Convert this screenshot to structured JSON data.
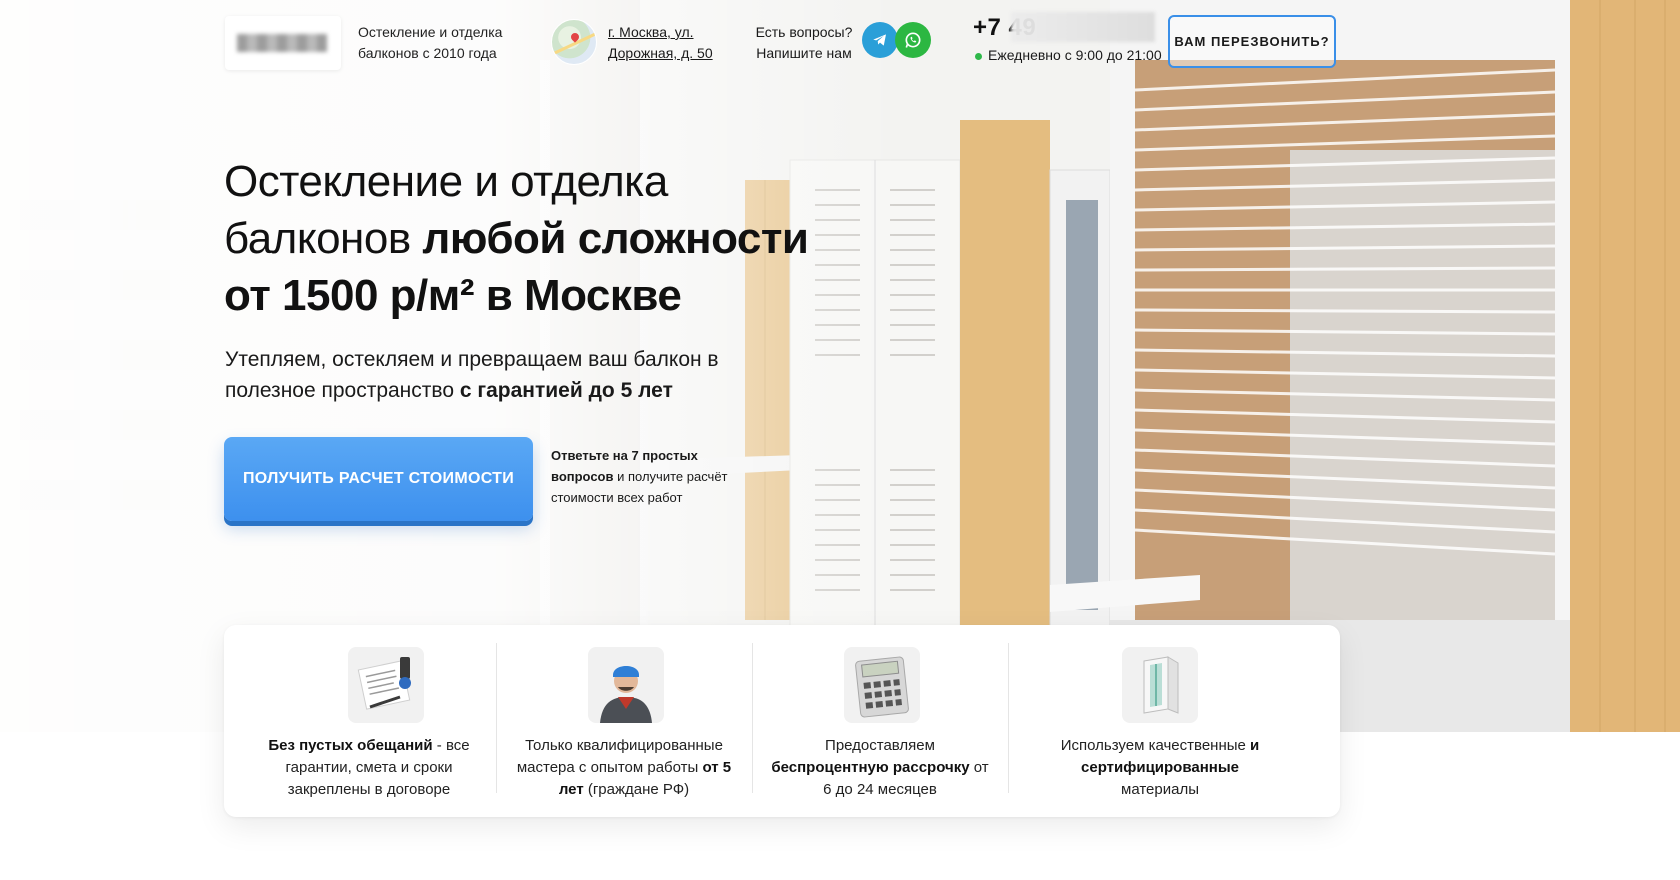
{
  "header": {
    "tagline": "Остекление и отделка балконов с 2010 года",
    "address_line1": "г. Москва, ул.",
    "address_line2": "Дорожная, д. 50",
    "questions_line1": "Есть вопросы?",
    "questions_line2": "Напишите нам",
    "phone": "+7 49",
    "hours": "Ежедневно с 9:00 до 21:00",
    "callback_label": "ВАМ ПЕРЕЗВОНИТЬ?"
  },
  "hero": {
    "title_line1": "Остекление и отделка",
    "title_line2_normal": "балконов ",
    "title_line2_bold": "любой сложности",
    "title_line3": "от 1500 р/м² в Москве",
    "subtitle_normal": "Утепляем, остекляем и превращаем ваш балкон в полезное пространство ",
    "subtitle_bold": "с гарантией до 5 лет",
    "cta_label": "ПОЛУЧИТЬ РАСЧЕТ СТОИМОСТИ",
    "cta_note_bold": "Ответьте на 7 простых вопросов",
    "cta_note_normal": " и получите расчёт стоимости всех работ"
  },
  "features": [
    {
      "icon": "document-icon",
      "bold": "Без пустых обещаний",
      "text_after": " - все гарантии, смета и сроки закреплены в договоре"
    },
    {
      "icon": "worker-icon",
      "text_before": "Только квалифицированные мастера с опытом работы ",
      "bold": "от 5 лет",
      "text_after": " (граждане РФ)"
    },
    {
      "icon": "calculator-icon",
      "text_before": "Предоставляем ",
      "bold": "беспроцентную рассрочку",
      "text_after": " от 6 до 24 месяцев"
    },
    {
      "icon": "window-profile-icon",
      "text_before": "Используем качественные ",
      "bold": "и сертифицированные",
      "text_after": " материалы"
    }
  ],
  "colors": {
    "accent_blue": "#3d90ee",
    "telegram": "#2a9fd8",
    "whatsapp": "#2cb742",
    "status_green": "#2eb84a"
  }
}
